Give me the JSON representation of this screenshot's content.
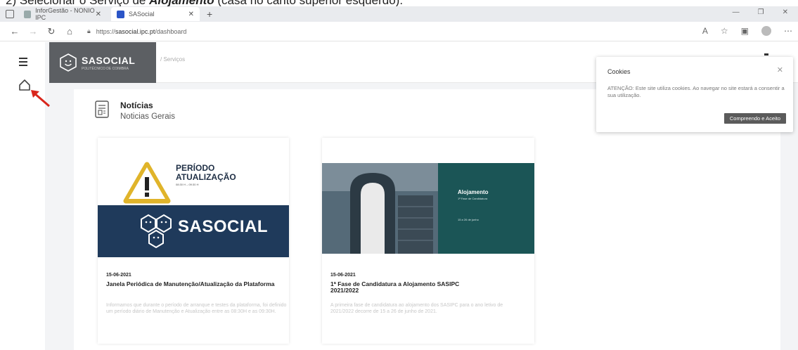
{
  "caption": {
    "prefix": "2)   Selecionar o Serviço de ",
    "highlight": "Alojamento",
    "suffix": " (casa no canto superior esquerdo)."
  },
  "browser": {
    "tabs": [
      {
        "label": "InforGestão - NONIO IPC",
        "active": false
      },
      {
        "label": "SASocial",
        "active": true
      }
    ],
    "new_tab": "+",
    "url_prefix": "https://",
    "url_host": "sasocial.ipc.pt",
    "url_path": "/dashboard",
    "window_controls": [
      "—",
      "❐",
      "✕"
    ]
  },
  "app": {
    "logo_text": "SASOCIAL",
    "logo_sub": "POLITÉCNICO DE COIMBRA",
    "breadcrumb": "/   Serviços"
  },
  "news": {
    "title": "Notícias",
    "subtitle": "Noticias Gerais",
    "cards": [
      {
        "banner_line1": "PERÍODO",
        "banner_line2": "ATUALIZAÇÃO",
        "banner_time": "08:30 H – 09:30 H",
        "banner_brand": "SASOCIAL",
        "date": "15-06-2021",
        "title": "Janela Periódica de Manutenção/Atualização da Plataforma",
        "text": "Informamos que durante o período de arranque e testes da plataforma, foi definido um período diário de Manutenção e Atualização entre as 08:30H e as 09:30H."
      },
      {
        "banner_title": "Alojamento",
        "banner_sub": "1ª Fase de Candidatura",
        "banner_dates": "15 a 26 de junho",
        "date": "15-06-2021",
        "title": "1ª Fase de Candidatura a Alojamento SASIPC 2021/2022",
        "text": "A primeira fase de candidatura ao alojamento dos SASIPC para o ano letivo de 2021/2022 decorre de 15 a 26 de junho de 2021."
      }
    ]
  },
  "cookies": {
    "title": "Cookies",
    "close": "✕",
    "text": "ATENÇÃO: Este site utiliza cookies. Ao navegar no site estará a consentir a sua utilização.",
    "button": "Compreendo e Aceito"
  },
  "colors": {
    "logo_bg": "#5c5f63",
    "banner_navy": "#1f3a5b",
    "banner_teal": "#1b5556",
    "arrow_red": "#d9261c"
  }
}
